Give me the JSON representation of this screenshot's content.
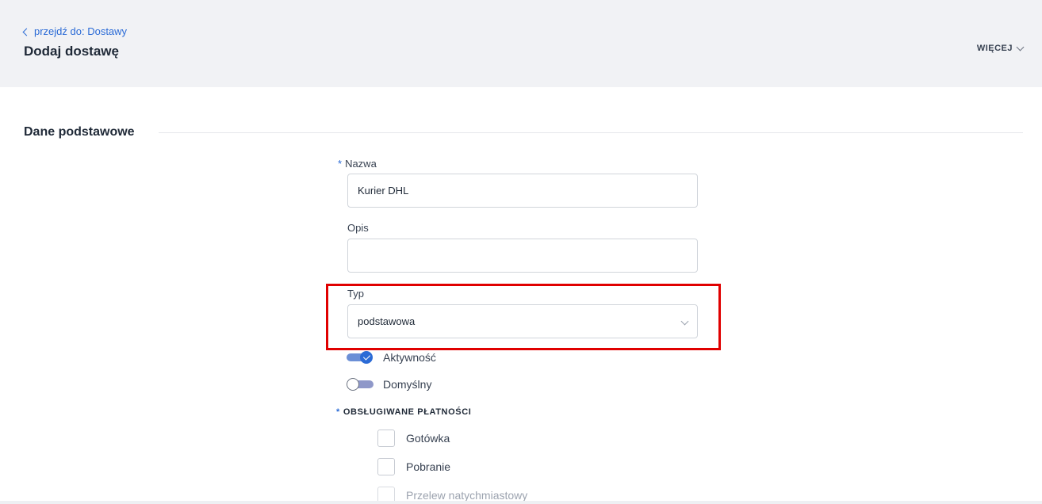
{
  "header": {
    "back_link": "przejdź do: Dostawy",
    "title": "Dodaj dostawę",
    "more_label": "WIĘCEJ"
  },
  "section": {
    "title": "Dane podstawowe"
  },
  "form": {
    "name": {
      "required_mark": "*",
      "label": "Nazwa",
      "value": "Kurier DHL"
    },
    "description": {
      "label": "Opis",
      "value": ""
    },
    "type": {
      "label": "Typ",
      "selected": "podstawowa"
    },
    "active": {
      "label": "Aktywność",
      "on": true
    },
    "default": {
      "label": "Domyślny",
      "on": false
    },
    "payments": {
      "required_mark": "*",
      "header": "OBSŁUGIWANE PŁATNOŚCI",
      "options": [
        {
          "label": "Gotówka",
          "checked": false
        },
        {
          "label": "Pobranie",
          "checked": false
        },
        {
          "label": "Przelew natychmiastowy",
          "checked": false
        }
      ]
    }
  },
  "colors": {
    "accent": "#2b6bd6",
    "highlight": "#e00000",
    "header_bg": "#f1f2f5"
  }
}
